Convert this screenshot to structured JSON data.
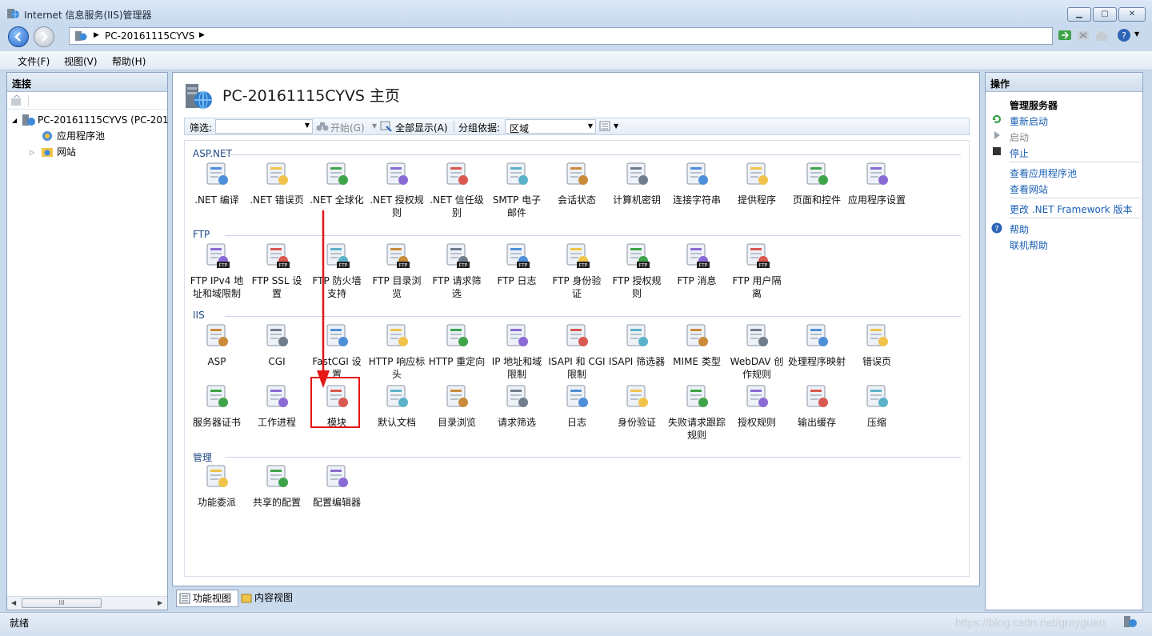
{
  "window": {
    "title": "Internet 信息服务(IIS)管理器"
  },
  "address": {
    "crumb": "PC-20161115CYVS"
  },
  "menu": [
    "文件(F)",
    "视图(V)",
    "帮助(H)"
  ],
  "left": {
    "header": "连接",
    "tree": [
      {
        "label": "PC-20161115CYVS (PC-201",
        "icon": "server-icon"
      },
      {
        "label": "应用程序池",
        "icon": "app-pool-icon"
      },
      {
        "label": "网站",
        "icon": "sites-icon"
      }
    ]
  },
  "center": {
    "title": "PC-20161115CYVS 主页",
    "filter_label": "筛选:",
    "start_label": "开始(G)",
    "show_all_label": "全部显示(A)",
    "group_label": "分组依据:",
    "group_value": "区域",
    "sections": [
      {
        "title": "ASP.NET",
        "items": [
          ".NET 编译",
          ".NET 错误页",
          ".NET 全球化",
          ".NET 授权规则",
          ".NET 信任级别",
          "SMTP 电子邮件",
          "会话状态",
          "计算机密钥",
          "连接字符串",
          "提供程序",
          "页面和控件",
          "应用程序设置"
        ]
      },
      {
        "title": "FTP",
        "items": [
          "FTP IPv4 地址和域限制",
          "FTP SSL 设置",
          "FTP 防火墙支持",
          "FTP 目录浏览",
          "FTP 请求筛选",
          "FTP 日志",
          "FTP 身份验证",
          "FTP 授权规则",
          "FTP 消息",
          "FTP 用户隔离"
        ]
      },
      {
        "title": "IIS",
        "items": [
          "ASP",
          "CGI",
          "FastCGI 设置",
          "HTTP 响应标头",
          "HTTP 重定向",
          "IP 地址和域限制",
          "ISAPI 和 CGI 限制",
          "ISAPI 筛选器",
          "MIME 类型",
          "WebDAV 创作规则",
          "处理程序映射",
          "错误页",
          "服务器证书",
          "工作进程",
          "模块",
          "默认文档",
          "目录浏览",
          "请求筛选",
          "日志",
          "身份验证",
          "失败请求跟踪规则",
          "授权规则",
          "输出缓存",
          "压缩"
        ]
      },
      {
        "title": "管理",
        "items": [
          "功能委派",
          "共享的配置",
          "配置编辑器"
        ]
      }
    ],
    "tabs": [
      "功能视图",
      "内容视图"
    ]
  },
  "right": {
    "header": "操作",
    "group_title": "管理服务器",
    "actions": [
      "重新启动",
      "启动",
      "停止",
      "查看应用程序池",
      "查看网站",
      "更改 .NET Framework 版本",
      "帮助",
      "联机帮助"
    ]
  },
  "status": {
    "text": "就绪",
    "watermark": "https://blog.csdn.net/grayguan"
  },
  "colors": {
    "highlight": "#e41616",
    "link": "#1a5fb4",
    "section": "#1f4a84"
  }
}
